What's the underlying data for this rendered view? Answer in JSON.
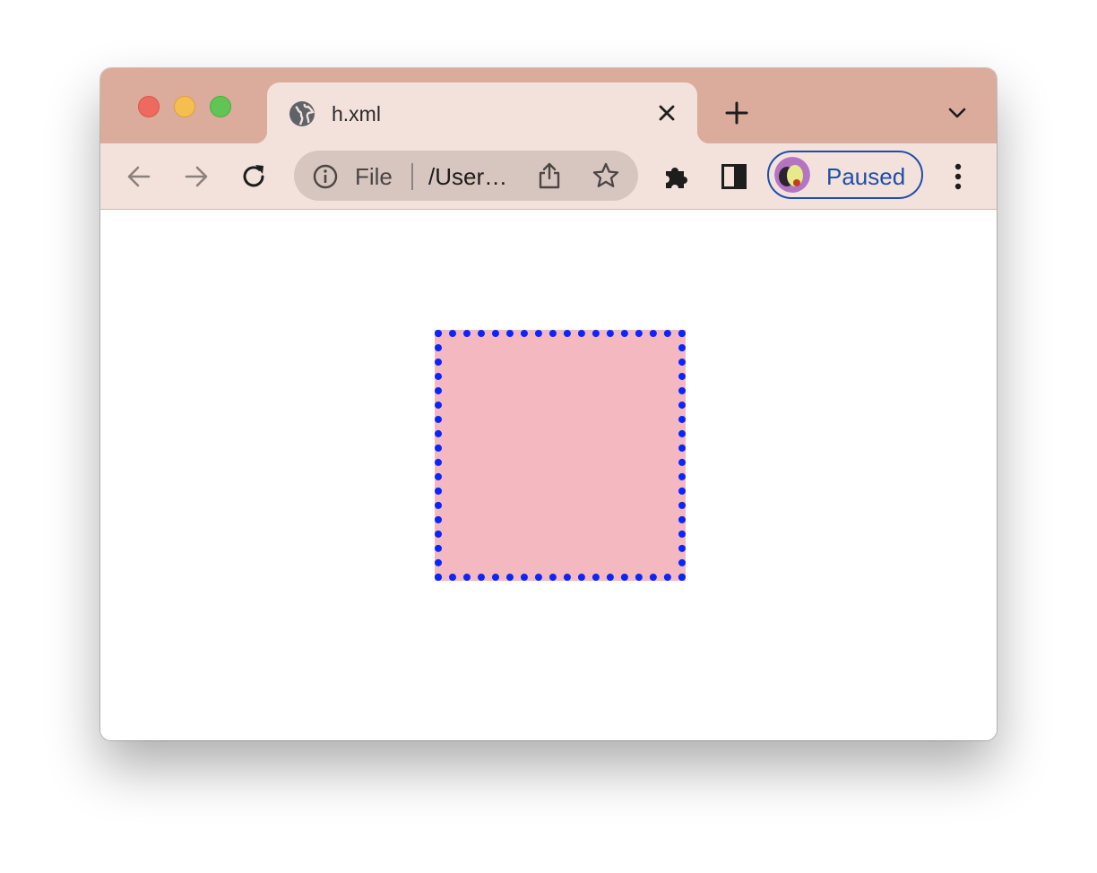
{
  "tab": {
    "title": "h.xml",
    "favicon": "globe-icon"
  },
  "omnibox": {
    "scheme_label": "File",
    "url_text": "/Users/...",
    "info_icon": "info-icon",
    "share_icon": "share-icon",
    "star_icon": "star-icon"
  },
  "toolbar": {
    "back_icon": "back-arrow-icon",
    "forward_icon": "forward-arrow-icon",
    "reload_icon": "reload-icon",
    "extensions_icon": "puzzle-icon",
    "side_panel_icon": "side-panel-icon",
    "menu_icon": "kebab-menu-icon"
  },
  "profile": {
    "label": "Paused"
  },
  "colors": {
    "tabstrip": "#dbab9c",
    "toolbar": "#f3e2dc",
    "box_fill": "#f4b8c0",
    "box_border": "#0a25ff",
    "profile_accent": "#1f4ea8"
  }
}
